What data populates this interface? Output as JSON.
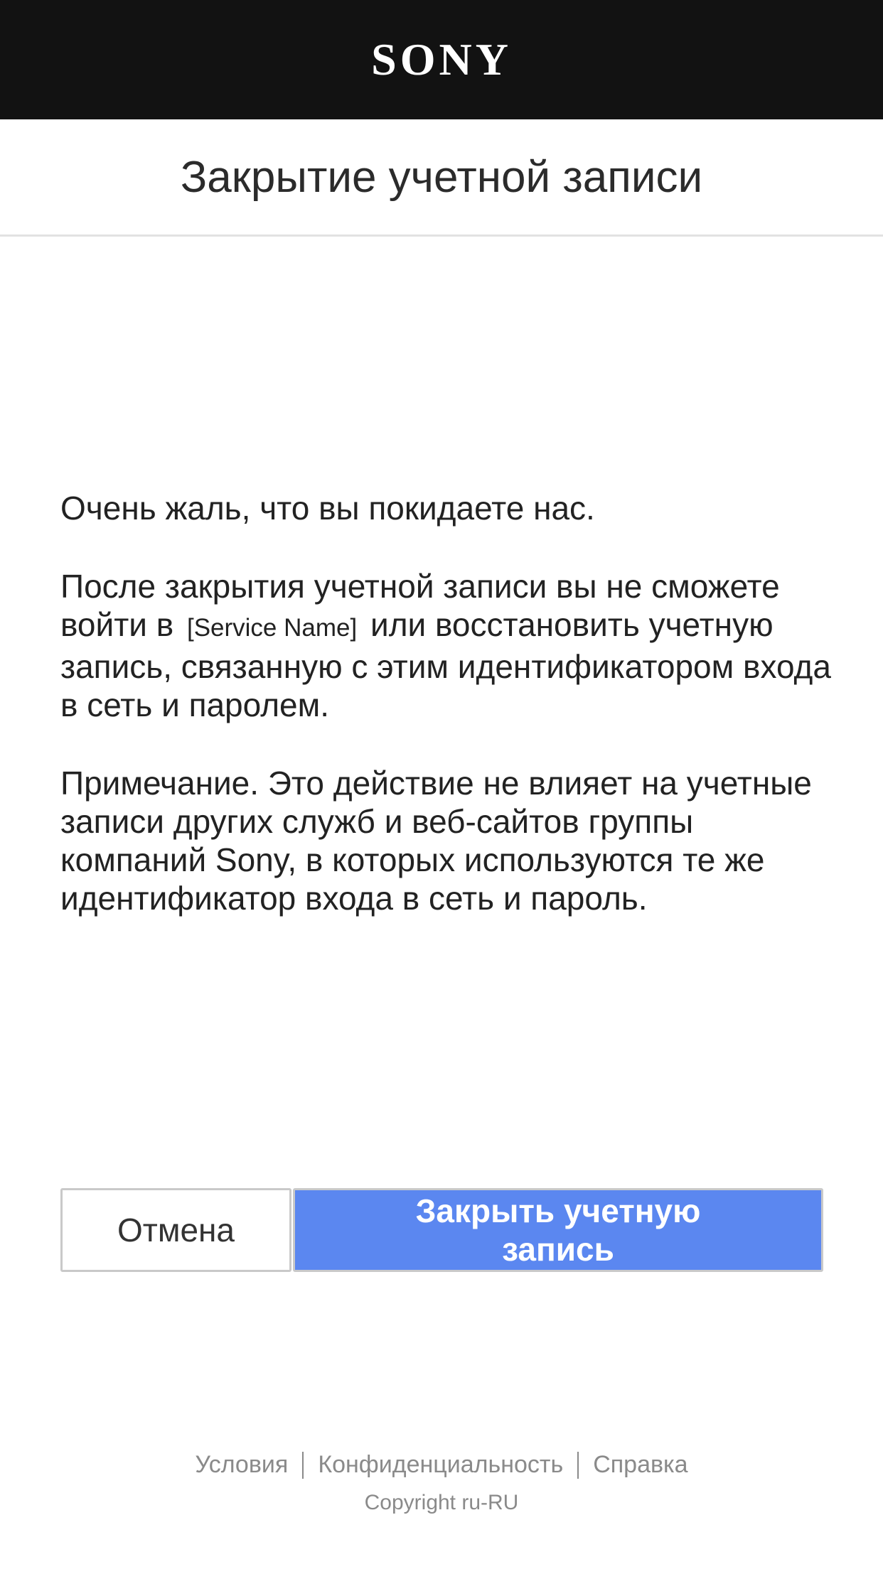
{
  "header": {
    "logo_text": "SONY",
    "background_color": "#121212"
  },
  "page_title": "Закрытие учетной записи",
  "content": {
    "sorry_text": "Очень жаль, что вы покидаете нас.",
    "info_prefix": "После закрытия учетной записи вы не сможете войти в",
    "service_name": "[Service Name]",
    "info_suffix": "или восстановить учетную запись, связанную с этим идентификатором входа в сеть и паролем.",
    "note_text": "Примечание. Это действие не влияет на учетные записи других служб и веб-сайтов группы компаний Sony, в которых используются те же идентификатор входа в сеть и пароль."
  },
  "buttons": {
    "cancel_label": "Отмена",
    "close_label": "Закрыть учетную запись",
    "primary_color": "#5b87f0"
  },
  "footer": {
    "links": [
      "Условия",
      "Конфиденциальность",
      "Справка"
    ],
    "copyright": "Copyright ru-RU"
  }
}
